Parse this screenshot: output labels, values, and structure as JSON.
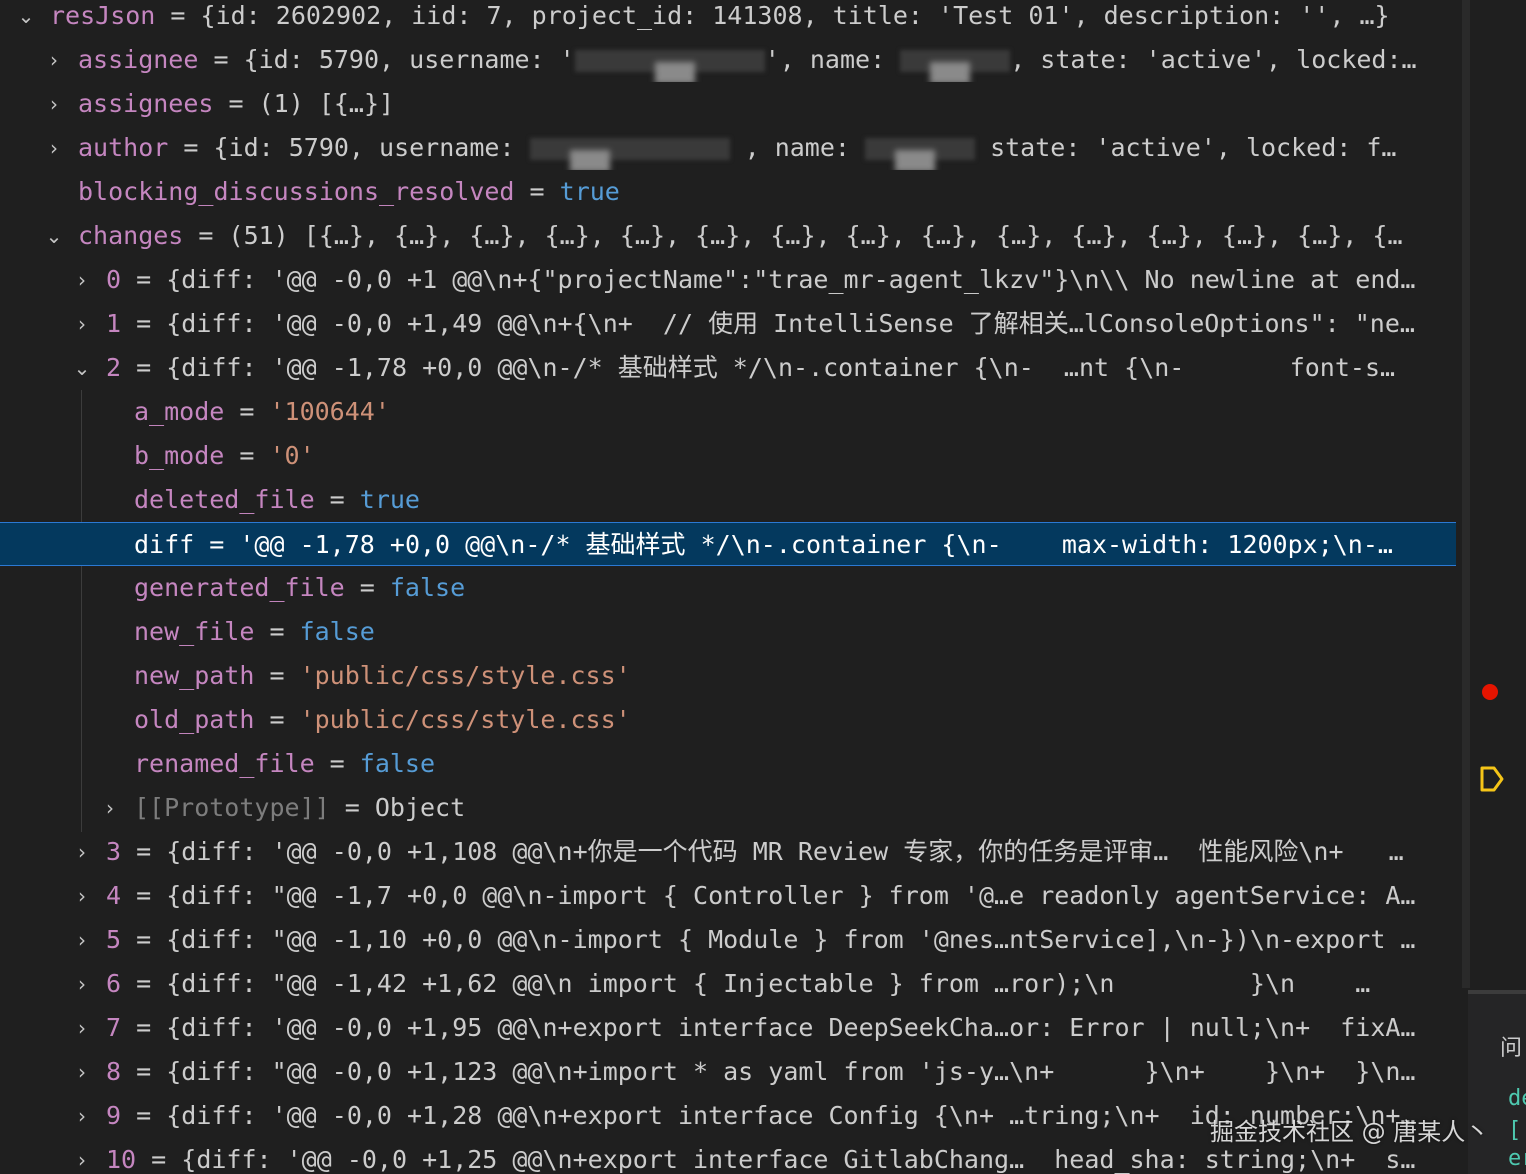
{
  "tree": [
    {
      "chev": "⌄",
      "key": "resJson",
      "eq": " = ",
      "val": "{id: 2602902, iid: 7, project_id: 141308, title: 'Test 01', description: '', …}",
      "kind": "obj"
    },
    {
      "chev": "›",
      "key": "assignee",
      "eq": " = ",
      "val": "{id: 5790, username: '",
      "val2": "', name: ",
      "val3": ", state: 'active', locked:…",
      "kind": "obj"
    },
    {
      "chev": "›",
      "key": "assignees",
      "eq": " = ",
      "val": "(1) [{…}]",
      "kind": "obj"
    },
    {
      "chev": "›",
      "key": "author",
      "eq": " = ",
      "val": "{id: 5790, username: ",
      "val2": " , name: ",
      "val3": " state: 'active', locked: f…",
      "kind": "obj"
    },
    {
      "chev": "",
      "key": "blocking_discussions_resolved",
      "eq": " = ",
      "val": "true",
      "kind": "bool"
    },
    {
      "chev": "⌄",
      "key": "changes",
      "eq": " = ",
      "val": "(51) [{…}, {…}, {…}, {…}, {…}, {…}, {…}, {…}, {…}, {…}, {…}, {…}, {…}, {…}, {…",
      "kind": "obj"
    },
    {
      "chev": "›",
      "key": "0",
      "eq": " = ",
      "val": "{diff: '@@ -0,0 +1 @@\\n+{\"projectName\":\"trae_mr-agent_lkzv\"}\\n\\\\ No newline at end…",
      "kind": "obj"
    },
    {
      "chev": "›",
      "key": "1",
      "eq": " = ",
      "val": "{diff: '@@ -0,0 +1,49 @@\\n+{\\n+  // 使用 IntelliSense 了解相关…lConsoleOptions\": \"ne…",
      "kind": "obj"
    },
    {
      "chev": "⌄",
      "key": "2",
      "eq": " = ",
      "val": "{diff: '@@ -1,78 +0,0 @@\\n-/* 基础样式 */\\n-.container {\\n-  …nt {\\n-       font-s…",
      "kind": "obj"
    },
    {
      "chev": "",
      "key": "a_mode",
      "eq": " = ",
      "val": "'100644'",
      "kind": "str"
    },
    {
      "chev": "",
      "key": "b_mode",
      "eq": " = ",
      "val": "'0'",
      "kind": "str"
    },
    {
      "chev": "",
      "key": "deleted_file",
      "eq": " = ",
      "val": "true",
      "kind": "bool"
    },
    {
      "chev": "",
      "key": "diff",
      "eq": " = ",
      "val": "'@@ -1,78 +0,0 @@\\n-/* 基础样式 */\\n-.container {\\n-    max-width: 1200px;\\n-…",
      "kind": "str",
      "selected": true
    },
    {
      "chev": "",
      "key": "generated_file",
      "eq": " = ",
      "val": "false",
      "kind": "bool"
    },
    {
      "chev": "",
      "key": "new_file",
      "eq": " = ",
      "val": "false",
      "kind": "bool"
    },
    {
      "chev": "",
      "key": "new_path",
      "eq": " = ",
      "val": "'public/css/style.css'",
      "kind": "str"
    },
    {
      "chev": "",
      "key": "old_path",
      "eq": " = ",
      "val": "'public/css/style.css'",
      "kind": "str"
    },
    {
      "chev": "",
      "key": "renamed_file",
      "eq": " = ",
      "val": "false",
      "kind": "bool"
    },
    {
      "chev": "›",
      "key": "[[Prototype]]",
      "eq": " = ",
      "val": "Object",
      "kind": "proto"
    },
    {
      "chev": "›",
      "key": "3",
      "eq": " = ",
      "val": "{diff: '@@ -0,0 +1,108 @@\\n+你是一个代码 MR Review 专家，你的任务是评审…  性能风险\\n+   …",
      "kind": "obj"
    },
    {
      "chev": "›",
      "key": "4",
      "eq": " = ",
      "val": "{diff: \"@@ -1,7 +0,0 @@\\n-import { Controller } from '@…e readonly agentService: A…",
      "kind": "obj"
    },
    {
      "chev": "›",
      "key": "5",
      "eq": " = ",
      "val": "{diff: \"@@ -1,10 +0,0 @@\\n-import { Module } from '@nes…ntService],\\n-})\\n-export …",
      "kind": "obj"
    },
    {
      "chev": "›",
      "key": "6",
      "eq": " = ",
      "val": "{diff: \"@@ -1,42 +1,62 @@\\n import { Injectable } from …ror);\\n         }\\n    …",
      "kind": "obj"
    },
    {
      "chev": "›",
      "key": "7",
      "eq": " = ",
      "val": "{diff: '@@ -0,0 +1,95 @@\\n+export interface DeepSeekCha…or: Error | null;\\n+  fixA…",
      "kind": "obj"
    },
    {
      "chev": "›",
      "key": "8",
      "eq": " = ",
      "val": "{diff: \"@@ -0,0 +1,123 @@\\n+import * as yaml from 'js-y…\\n+      }\\n+    }\\n+  }\\n…",
      "kind": "obj"
    },
    {
      "chev": "›",
      "key": "9",
      "eq": " = ",
      "val": "{diff: '@@ -0,0 +1,28 @@\\n+export interface Config {\\n+ …tring;\\n+  id: number;\\n+…",
      "kind": "obj"
    },
    {
      "chev": "›",
      "key": "10",
      "eq": " = ",
      "val": "{diff: '@@ -0,0 +1,25 @@\\n+export interface GitlabChang…  head_sha: string;\\n+  s…",
      "kind": "obj"
    }
  ],
  "side_panel": {
    "title": "问",
    "lines": [
      "de",
      "[",
      "er"
    ]
  },
  "watermark": "掘金技术社区 @ 唐某人丶",
  "colors": {
    "background": "#1f1f1f",
    "key": "#c586c0",
    "string": "#ce9178",
    "boolean": "#569cd6",
    "selection": "#04395e",
    "breakpoint": "#e51400",
    "debug_arrow": "#f5c518"
  },
  "icons": [
    "chevron-down-icon",
    "chevron-right-icon",
    "breakpoint-icon",
    "debug-arrow-icon"
  ]
}
